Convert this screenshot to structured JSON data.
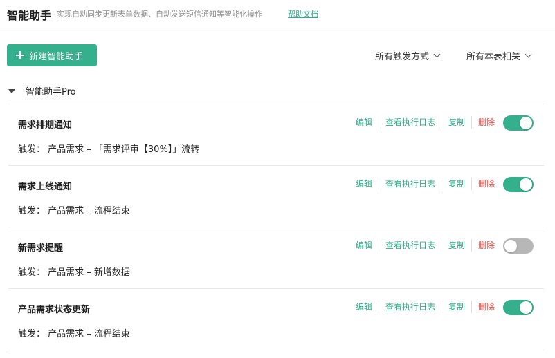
{
  "header": {
    "title": "智能助手",
    "subtitle": "实现自动同步更新表单数据、自动发送短信通知等智能化操作",
    "help_link": "帮助文档"
  },
  "toolbar": {
    "new_button": "新建智能助手",
    "filter_trigger": "所有触发方式",
    "filter_scope": "所有本表相关"
  },
  "group": {
    "name": "智能助手Pro",
    "expanded": true
  },
  "actions": {
    "edit": "编辑",
    "log": "查看执行日志",
    "copy": "复制",
    "delete": "删除"
  },
  "colors": {
    "accent": "#35b08d",
    "link": "#2fab8a",
    "danger": "#e5534b",
    "toggle_off": "#b7b7b7"
  },
  "rules": [
    {
      "name": "需求排期通知",
      "trigger": "触发：  产品需求 – 「需求评审【30%】」流转",
      "enabled": true
    },
    {
      "name": "需求上线通知",
      "trigger": "触发：  产品需求 – 流程结束",
      "enabled": true
    },
    {
      "name": "新需求提醒",
      "trigger": "触发：  产品需求 – 新增数据",
      "enabled": false
    },
    {
      "name": "产品需求状态更新",
      "trigger": "触发：  产品需求 – 流程结束",
      "enabled": true
    }
  ]
}
